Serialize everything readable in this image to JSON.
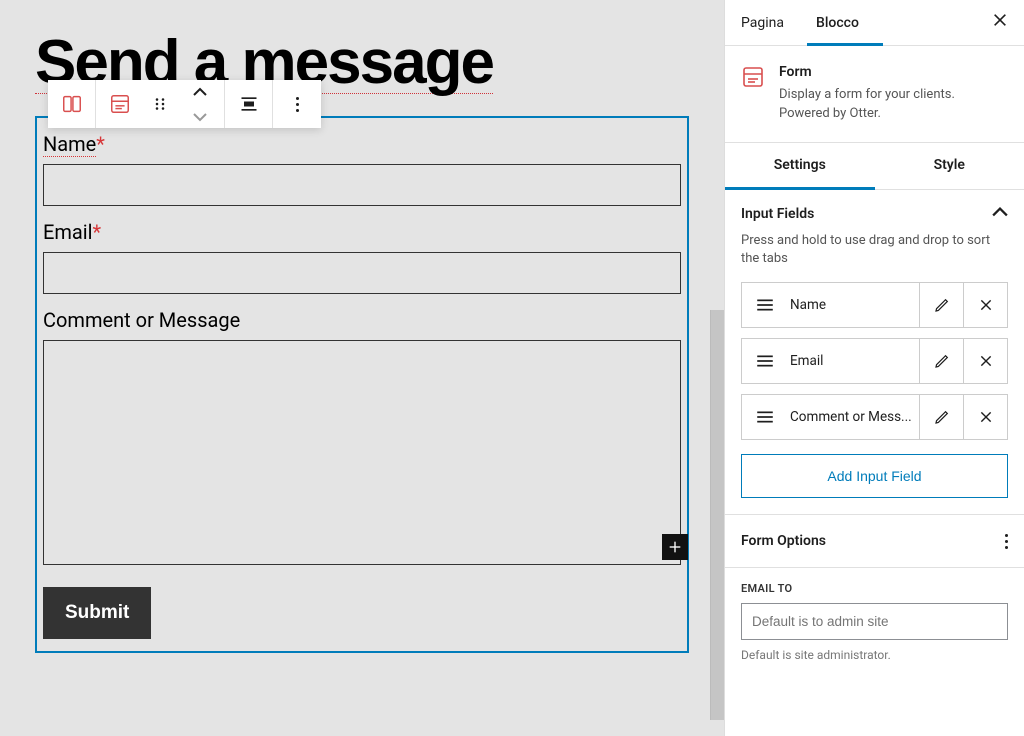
{
  "editor": {
    "page_title": "Send a message",
    "form": {
      "fields": [
        {
          "label": "Name",
          "required": true,
          "underline": true,
          "type": "text"
        },
        {
          "label": "Email",
          "required": true,
          "underline": false,
          "type": "text"
        },
        {
          "label": "Comment or Message",
          "required": false,
          "underline": false,
          "type": "textarea"
        }
      ],
      "submit_label": "Submit"
    }
  },
  "sidebar": {
    "tabs": {
      "page": "Pagina",
      "block": "Blocco"
    },
    "block": {
      "name": "Form",
      "description": "Display a form for your clients. Powered by Otter."
    },
    "sub_tabs": {
      "settings": "Settings",
      "style": "Style"
    },
    "input_fields": {
      "title": "Input Fields",
      "hint": "Press and hold to use drag and drop to sort the tabs",
      "items": [
        "Name",
        "Email",
        "Comment or Mess..."
      ],
      "add_label": "Add Input Field"
    },
    "form_options": {
      "title": "Form Options"
    },
    "email_to": {
      "label": "EMAIL TO",
      "placeholder": "Default is to admin site",
      "help": "Default is site administrator."
    }
  },
  "colors": {
    "accent": "#007cba",
    "danger": "#d63638"
  }
}
